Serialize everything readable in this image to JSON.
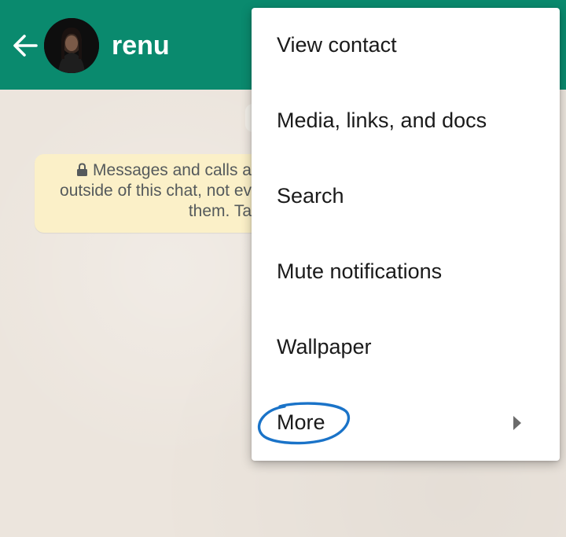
{
  "header": {
    "contact_name": "renu",
    "back_icon": "arrow-left-icon",
    "avatar_icon": "contact-avatar"
  },
  "chat": {
    "encryption_notice": {
      "line1": "Messages and calls a",
      "line2": "outside of this chat, not ev",
      "line3": "them. Ta"
    }
  },
  "menu": {
    "items": [
      {
        "label": "View contact"
      },
      {
        "label": "Media, links, and docs"
      },
      {
        "label": "Search"
      },
      {
        "label": "Mute notifications"
      },
      {
        "label": "Wallpaper"
      },
      {
        "label": "More",
        "has_submenu": true
      }
    ]
  },
  "colors": {
    "header": "#0a8a6e",
    "chat_background": "#ece5dd",
    "notice_background": "#fbf0c8",
    "annotation": "#1a73c8"
  }
}
